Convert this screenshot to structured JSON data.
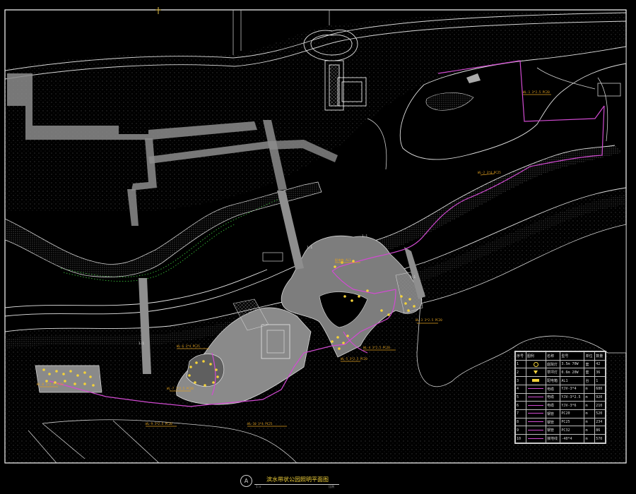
{
  "drawing": {
    "colors": {
      "background": "#000000",
      "linework": "#e6e6e6",
      "hatch": "#7a7a7a",
      "circuit": "#d24bd2",
      "fixture": "#f3d23a",
      "label": "#e0a020",
      "vegetation": "#3ecf3e",
      "frame": "#ffffff"
    },
    "title": {
      "marker": "A",
      "text": "滨水带状公园照明平面图",
      "scale_left": "1:x",
      "scale_right": "比例"
    },
    "callouts": [
      {
        "id": "c1",
        "text": "WL-1 3*2.5 PC20"
      },
      {
        "id": "c2",
        "text": "WL-2 3*4 PC25"
      },
      {
        "id": "c3",
        "text": "WL-3 3*2.5 PC20"
      },
      {
        "id": "c4",
        "text": "WL-4 3*2.5 PC20"
      },
      {
        "id": "c5",
        "text": "WL-5 3*2.5 PC20"
      },
      {
        "id": "c6",
        "text": "WL-6 3*4 PC25"
      },
      {
        "id": "c7",
        "text": "WL-7 3*2.5 PC20"
      },
      {
        "id": "c8",
        "text": "WL-8 3*2.5 PC20"
      },
      {
        "id": "c9",
        "text": "WL-9 3*2.5 PC20"
      },
      {
        "id": "c10",
        "text": "WL-10 3*4 PC25"
      },
      {
        "id": "c11",
        "text": "配电箱 AL1"
      }
    ],
    "map_labels": [
      {
        "id": "m1",
        "text": "1:1"
      },
      {
        "id": "m2",
        "text": "1:1"
      },
      {
        "id": "m3",
        "text": "1:1"
      },
      {
        "id": "m4",
        "text": "1:1"
      }
    ]
  },
  "legend": {
    "headers": [
      "序号",
      "图例",
      "名称",
      "型号",
      "单位",
      "数量"
    ],
    "rows": [
      {
        "no": "1",
        "symbol": "lamp",
        "name": "庭院灯",
        "model": "3.5m 70W",
        "unit": "套",
        "qty": "42"
      },
      {
        "no": "2",
        "symbol": "tri",
        "name": "草坪灯",
        "model": "0.6m 20W",
        "unit": "套",
        "qty": "36"
      },
      {
        "no": "3",
        "symbol": "block",
        "name": "配电箱",
        "model": "AL1",
        "unit": "台",
        "qty": "1"
      },
      {
        "no": "4",
        "symbol": "line",
        "name": "电缆",
        "model": "YJV-3*4",
        "unit": "m",
        "qty": "680"
      },
      {
        "no": "5",
        "symbol": "line",
        "name": "电缆",
        "model": "YJV-3*2.5",
        "unit": "m",
        "qty": "920"
      },
      {
        "no": "6",
        "symbol": "line",
        "name": "电缆",
        "model": "YJV-3*6",
        "unit": "m",
        "qty": "210"
      },
      {
        "no": "7",
        "symbol": "line",
        "name": "钢管",
        "model": "PC20",
        "unit": "m",
        "qty": "520"
      },
      {
        "no": "8",
        "symbol": "line",
        "name": "钢管",
        "model": "PC25",
        "unit": "m",
        "qty": "234"
      },
      {
        "no": "9",
        "symbol": "line",
        "name": "钢管",
        "model": "PC32",
        "unit": "m",
        "qty": "86"
      },
      {
        "no": "10",
        "symbol": "line",
        "name": "接地线",
        "model": "-40*4",
        "unit": "m",
        "qty": "570"
      }
    ]
  }
}
